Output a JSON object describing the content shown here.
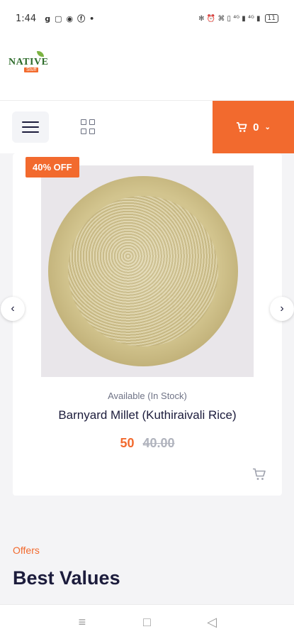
{
  "status_bar": {
    "time": "1:44",
    "app_icons": [
      "g",
      "▢",
      "◉",
      "ⓕ",
      "•"
    ],
    "right_icons": "✻ ⏰ ⌘ ▯ ⁴ᴳ ▮ ⁴ᴳ ▮",
    "battery": "11"
  },
  "header": {
    "logo_text": "NATIVE",
    "logo_sub": "Stuff"
  },
  "nav": {
    "menu_icon": "hamburger-icon",
    "grid_icon": "grid-icon",
    "cart_count": "0",
    "cart_chevron": "⌄"
  },
  "product": {
    "badge": "40% OFF",
    "availability": "Available (In Stock)",
    "title": "Barnyard Millet (Kuthiraivali Rice)",
    "price": "50",
    "old_price": "40.00"
  },
  "carousel": {
    "prev_glyph": "‹",
    "next_glyph": "›"
  },
  "section": {
    "eyebrow": "Offers",
    "title": "Best Values"
  },
  "system_nav": {
    "recents": "≡",
    "home": "□",
    "back": "◁"
  },
  "colors": {
    "accent": "#f26a2e",
    "text": "#1c1c3c"
  }
}
